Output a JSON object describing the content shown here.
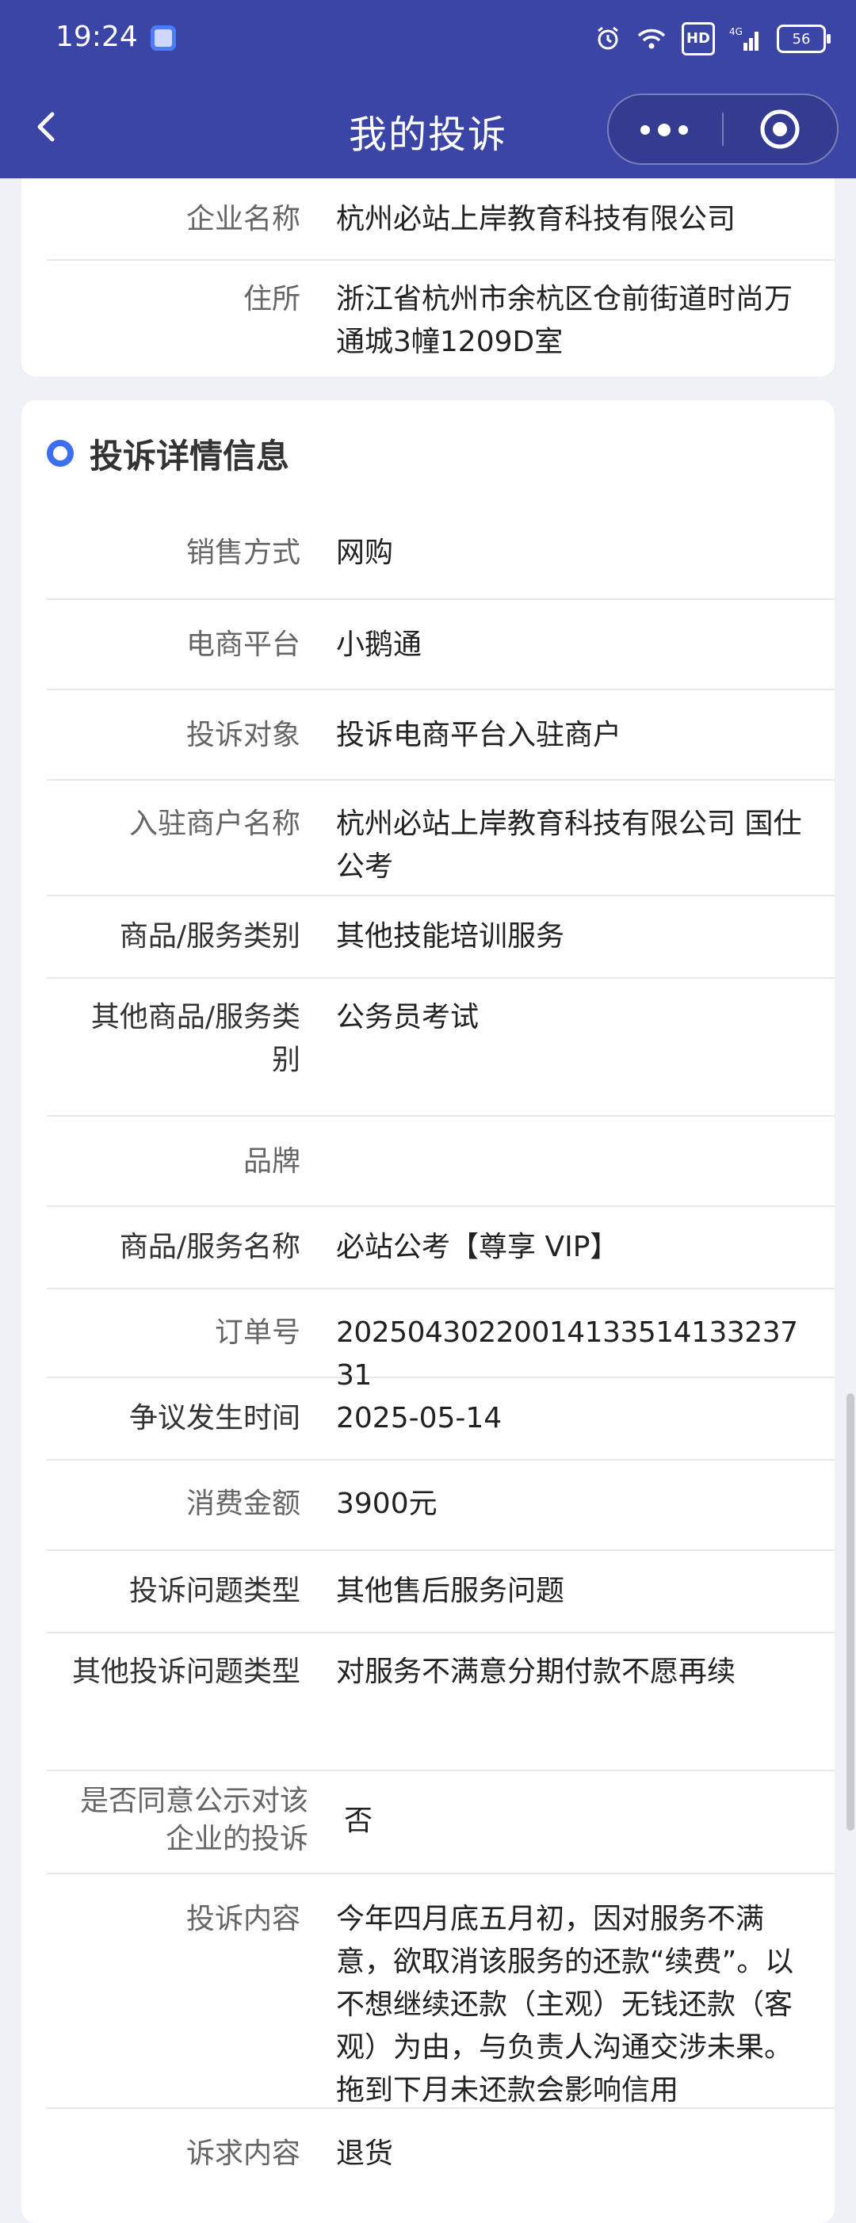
{
  "status_bar": {
    "time": "19:24",
    "hd": "HD",
    "signal": "4G",
    "battery": "56"
  },
  "nav": {
    "title": "我的投诉",
    "icons": [
      "back-icon",
      "more-icon",
      "target-icon"
    ]
  },
  "company": {
    "rows": [
      {
        "label": "企业名称",
        "value": "杭州必站上岸教育科技有限公司"
      },
      {
        "label": "住所",
        "value": "浙江省杭州市余杭区仓前街道时尚万通城3幢1209D室"
      }
    ]
  },
  "complaint": {
    "section_title": "投诉详情信息",
    "rows": [
      {
        "label": "销售方式",
        "value": "网购"
      },
      {
        "label": "电商平台",
        "value": "小鹅通"
      },
      {
        "label": "投诉对象",
        "value": "投诉电商平台入驻商户"
      },
      {
        "label": "入驻商户名称",
        "value": "杭州必站上岸教育科技有限公司 国仕公考"
      },
      {
        "label": "商品/服务类别",
        "value": "其他技能培训服务"
      },
      {
        "label": "其他商品/服务类别",
        "value": "公务员考试"
      },
      {
        "label": "品牌",
        "value": ""
      },
      {
        "label": "商品/服务名称",
        "value": "必站公考【尊享 VIP】"
      },
      {
        "label": "订单号",
        "value": "20250430220014133514133237 31"
      },
      {
        "label": "争议发生时间",
        "value": "2025-05-14"
      },
      {
        "label": "消费金额",
        "value": "3900元"
      },
      {
        "label": "投诉问题类型",
        "value": "其他售后服务问题"
      },
      {
        "label": "其他投诉问题类型",
        "value": "对服务不满意分期付款不愿再续"
      },
      {
        "label": "是否同意公示对该企业的投诉",
        "value": "否"
      },
      {
        "label": "投诉内容",
        "value": "今年四月底五月初，因对服务不满意，欲取消该服务的还款“续费”。以不想继续还款（主观）无钱还款（客观）为由，与负责人沟通交涉未果。拖到下月未还款会影响信用"
      },
      {
        "label": "诉求内容",
        "value": "退货"
      }
    ]
  }
}
